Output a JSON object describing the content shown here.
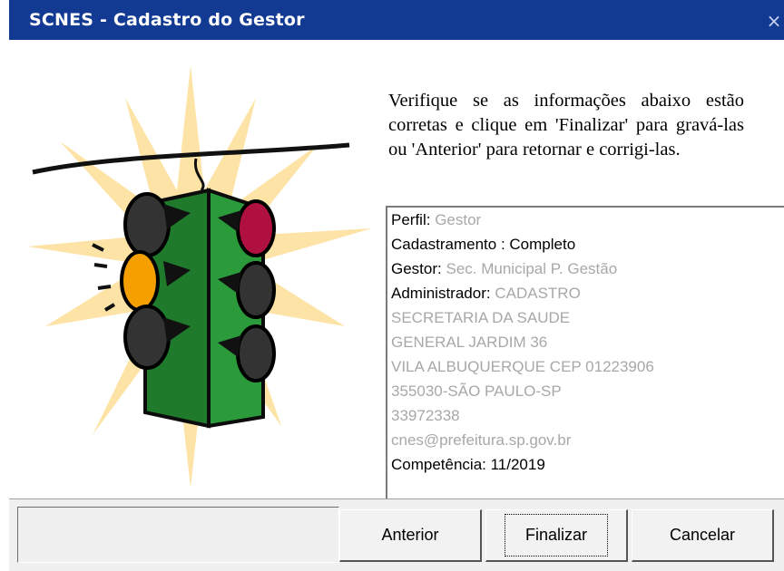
{
  "window": {
    "title": "SCNES - Cadastro do Gestor",
    "close_glyph": "×",
    "colors": {
      "titlebar": "#123a93",
      "footer": "#f0f0f0"
    }
  },
  "illustration": {
    "icon": "traffic-light-icon",
    "lit_top_right": "#b01040",
    "lit_middle_left": "#f5a000"
  },
  "instructions": {
    "text": "Verifique se as informações abaixo estão corretas e clique  em 'Finalizar' para gravá-las ou 'Anterior' para retornar e corrigi-las."
  },
  "info": {
    "perfil_label": "Perfil:",
    "perfil_value": "Gestor",
    "cadastramento": "Cadastramento : Completo",
    "gestor_label": "Gestor:",
    "gestor_value": "Sec. Municipal P. Gestão",
    "administrador_label": "Administrador:",
    "administrador_value": "CADASTRO",
    "secretaria": "SECRETARIA DA SAUDE",
    "endereco": "GENERAL JARDIM 36",
    "bairro_cep": "VILA ALBUQUERQUE  CEP 01223906",
    "municipio": "355030-SÃO PAULO-SP",
    "telefone": "33972338",
    "email": "cnes@prefeitura.sp.gov.br",
    "competencia": "Competência: 11/2019"
  },
  "buttons": {
    "anterior": "Anterior",
    "finalizar": "Finalizar",
    "cancelar": "Cancelar"
  }
}
